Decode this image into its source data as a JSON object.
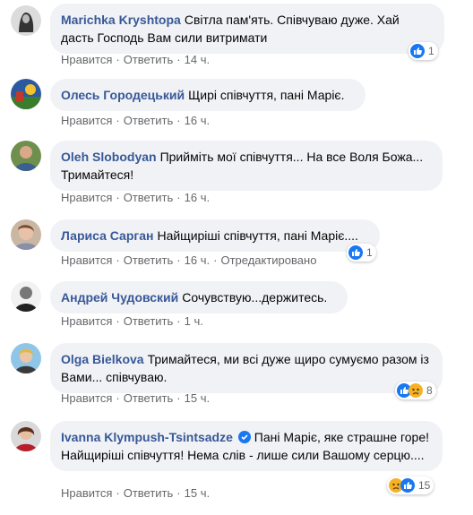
{
  "actions": {
    "like": "Нравится",
    "reply": "Ответить",
    "edited": "Отредактировано",
    "sep": "·"
  },
  "comments": [
    {
      "author": "Marichka Kryshtopa",
      "text": "Світла пам'ять. Співчуваю дуже. Хай дасть Господь Вам сили витримати",
      "time": "14 ч.",
      "reactions": {
        "types": [
          "like"
        ],
        "count": "1"
      }
    },
    {
      "author": "Олесь Городецький",
      "text": "Щирі співчуття, пані Маріє.",
      "time": "16 ч."
    },
    {
      "author": "Oleh Slobodyan",
      "text": "Прийміть мої співчуття... На все Воля Божа... Тримайтеся!",
      "time": "16 ч."
    },
    {
      "author": "Лариса Сарган",
      "text": "Найщиріші співчуття, пані Маріє....",
      "time": "16 ч.",
      "edited": true,
      "reactions": {
        "types": [
          "like"
        ],
        "count": "1"
      }
    },
    {
      "author": "Андрей Чудовский",
      "text": "Сочувствую...держитесь.",
      "time": "1 ч."
    },
    {
      "author": "Olga Bielkova",
      "text": "Тримайтеся, ми всі дуже щиро сумуємо разом із Вами... співчуваю.",
      "time": "15 ч.",
      "reactions": {
        "types": [
          "like",
          "sad"
        ],
        "count": "8"
      }
    },
    {
      "author": "Ivanna Klympush-Tsintsadze",
      "verified": true,
      "text": "Пані Маріє, яке страшне горе! Найщиріші співчуття! Нема слів - лише сили Вашому серцю....",
      "time": "15 ч.",
      "reactions": {
        "types": [
          "sad",
          "like"
        ],
        "count": "15"
      }
    }
  ]
}
